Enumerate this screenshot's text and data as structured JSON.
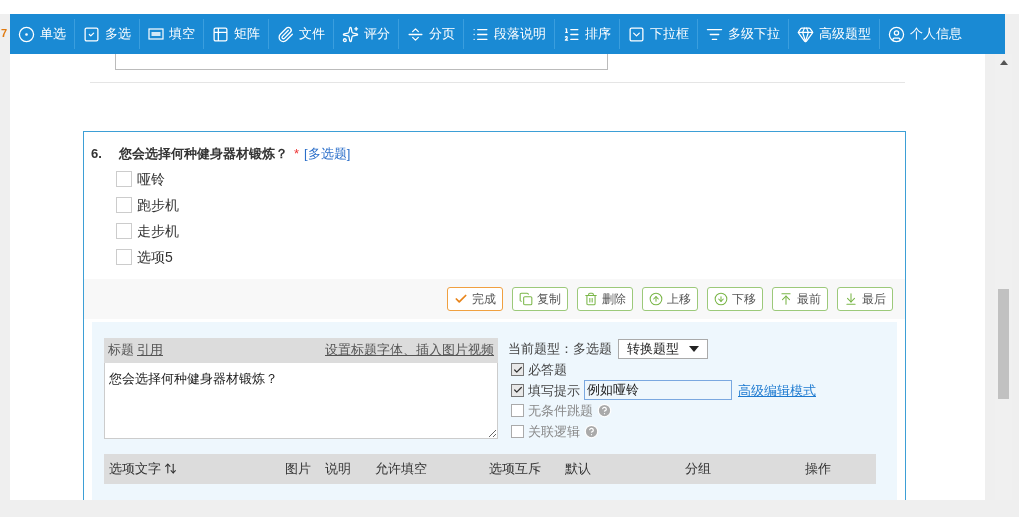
{
  "page_marker": "7",
  "toolbar": [
    {
      "kind": "radio",
      "label": "单选"
    },
    {
      "kind": "checkbox",
      "label": "多选"
    },
    {
      "kind": "fill",
      "label": "填空"
    },
    {
      "kind": "matrix",
      "label": "矩阵"
    },
    {
      "kind": "file",
      "label": "文件"
    },
    {
      "kind": "rating",
      "label": "评分"
    },
    {
      "kind": "page",
      "label": "分页"
    },
    {
      "kind": "paragraph",
      "label": "段落说明"
    },
    {
      "kind": "sort",
      "label": "排序"
    },
    {
      "kind": "dropdown",
      "label": "下拉框"
    },
    {
      "kind": "multidropdown",
      "label": "多级下拉"
    },
    {
      "kind": "advanced",
      "label": "高级题型"
    },
    {
      "kind": "profile",
      "label": "个人信息"
    }
  ],
  "question": {
    "number": "6.",
    "title": "您会选择何种健身器材锻炼？",
    "required_mark": "*",
    "type_tag": "[多选题]",
    "options": [
      {
        "label": "哑铃",
        "checked": false
      },
      {
        "label": "跑步机",
        "checked": false
      },
      {
        "label": "走步机",
        "checked": false
      },
      {
        "label": "选项5",
        "checked": false
      }
    ]
  },
  "actions": [
    {
      "kind": "done",
      "label": "完成"
    },
    {
      "kind": "copy",
      "label": "复制"
    },
    {
      "kind": "delete",
      "label": "删除"
    },
    {
      "kind": "up",
      "label": "上移"
    },
    {
      "kind": "down",
      "label": "下移"
    },
    {
      "kind": "top",
      "label": "最前"
    },
    {
      "kind": "bottom",
      "label": "最后"
    }
  ],
  "editor": {
    "label": "标题",
    "quote_link": "引用",
    "font_link": "设置标题字体、插入图片视频",
    "value": "您会选择何种健身器材锻炼？"
  },
  "type_info": {
    "label": "当前题型：多选题",
    "convert_select": "转换题型"
  },
  "settings": [
    {
      "kind": "plain",
      "label": "必答题",
      "checked": true
    },
    {
      "kind": "hint",
      "label": "填写提示",
      "checked": true,
      "value": "例如哑铃",
      "link": "高级编辑模式"
    },
    {
      "kind": "help",
      "label": "无条件跳题",
      "checked": false
    },
    {
      "kind": "help",
      "label": "关联逻辑",
      "checked": false
    }
  ],
  "table": {
    "columns": [
      "选项文字",
      "图片",
      "说明",
      "允许填空",
      "选项互斥",
      "默认",
      "分组",
      "操作"
    ]
  }
}
